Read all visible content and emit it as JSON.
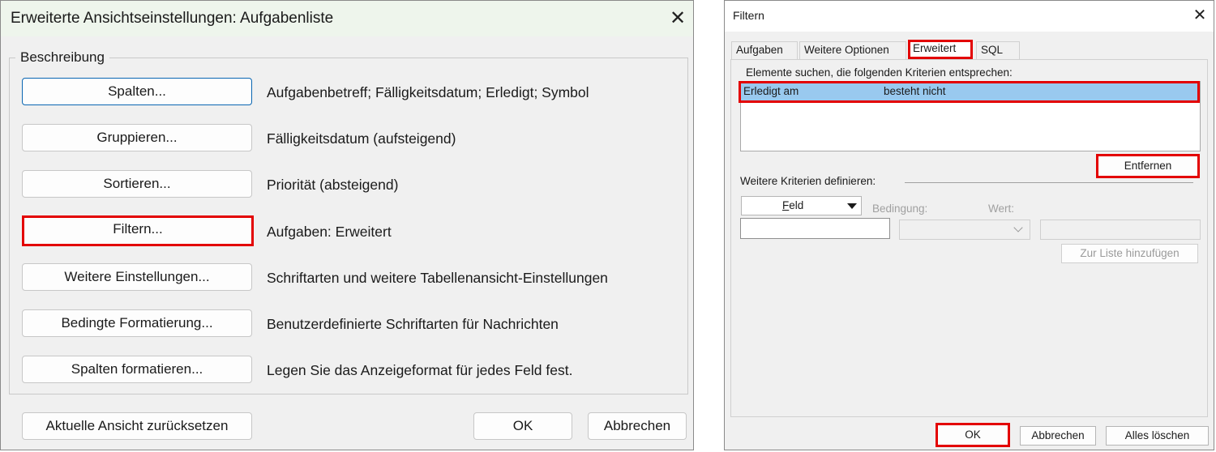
{
  "advanced_view_dialog": {
    "title": "Erweiterte Ansichtseinstellungen: Aufgabenliste",
    "close_label": "✕",
    "group_label": "Beschreibung",
    "rows": [
      {
        "button": "Spalten...",
        "description": "Aufgabenbetreff; Fälligkeitsdatum; Erledigt; Symbol"
      },
      {
        "button": "Gruppieren...",
        "description": "Fälligkeitsdatum (aufsteigend)"
      },
      {
        "button": "Sortieren...",
        "description": "Priorität (absteigend)"
      },
      {
        "button": "Filtern...",
        "description": "Aufgaben: Erweitert"
      },
      {
        "button": "Weitere Einstellungen...",
        "description": "Schriftarten und weitere Tabellenansicht-Einstellungen"
      },
      {
        "button": "Bedingte Formatierung...",
        "description": "Benutzerdefinierte Schriftarten für Nachrichten"
      },
      {
        "button": "Spalten formatieren...",
        "description": "Legen Sie das Anzeigeformat für jedes Feld fest."
      }
    ],
    "reset_button": "Aktuelle Ansicht zurücksetzen",
    "ok_button": "OK",
    "cancel_button": "Abbrechen"
  },
  "filter_dialog": {
    "title": "Filtern",
    "close_label": "✕",
    "tabs": [
      "Aufgaben",
      "Weitere Optionen",
      "Erweitert",
      "SQL"
    ],
    "active_tab": "Erweitert",
    "criteria_label": "Elemente suchen, die folgenden Kriterien entsprechen:",
    "criteria": [
      {
        "field": "Erledigt am",
        "condition": "besteht nicht"
      }
    ],
    "remove_button": "Entfernen",
    "define_label": "Weitere Kriterien definieren:",
    "field_button": "Feld",
    "field_button_mnemonic": "F",
    "field_button_rest": "eld",
    "condition_label": "Bedingung:",
    "value_label": "Wert:",
    "add_button": "Zur Liste hinzufügen",
    "ok_button": "OK",
    "cancel_button": "Abbrechen",
    "clear_button": "Alles löschen"
  },
  "colors": {
    "highlight_border": "#e30000",
    "selected_row": "#99c9ef",
    "default_button_border": "#0a66b2",
    "title_bar": "#eef5ec"
  }
}
